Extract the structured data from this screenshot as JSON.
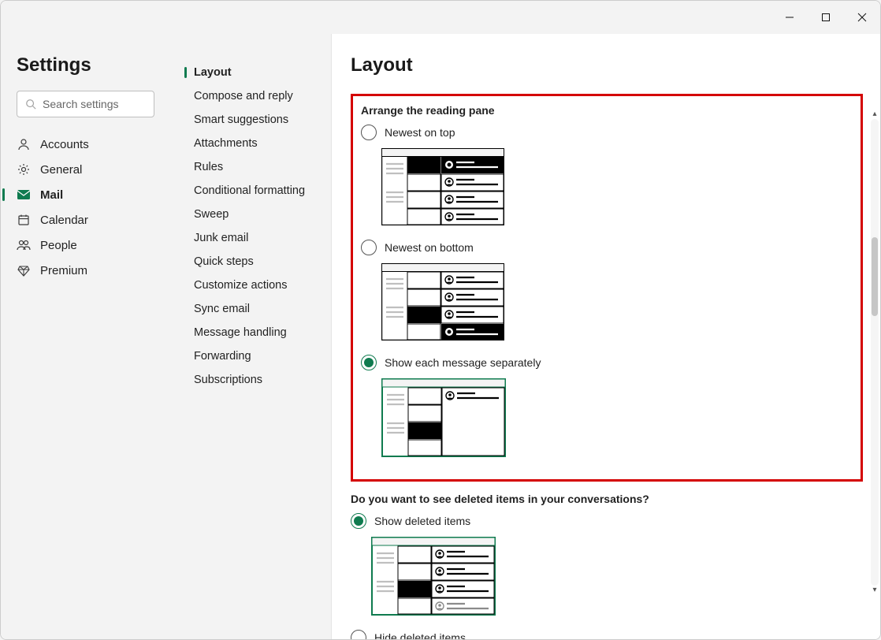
{
  "window_controls": {
    "minimize": "minimize",
    "maximize": "maximize",
    "close": "close"
  },
  "page_title": "Settings",
  "search": {
    "placeholder": "Search settings"
  },
  "primary_nav": [
    {
      "id": "accounts",
      "icon": "person",
      "label": "Accounts"
    },
    {
      "id": "general",
      "icon": "gear",
      "label": "General"
    },
    {
      "id": "mail",
      "icon": "mail",
      "label": "Mail",
      "active": true
    },
    {
      "id": "calendar",
      "icon": "calendar",
      "label": "Calendar"
    },
    {
      "id": "people",
      "icon": "people",
      "label": "People"
    },
    {
      "id": "premium",
      "icon": "diamond",
      "label": "Premium"
    }
  ],
  "secondary_nav": [
    {
      "id": "layout",
      "label": "Layout",
      "active": true
    },
    {
      "id": "compose",
      "label": "Compose and reply"
    },
    {
      "id": "smart",
      "label": "Smart suggestions"
    },
    {
      "id": "attachments",
      "label": "Attachments"
    },
    {
      "id": "rules",
      "label": "Rules"
    },
    {
      "id": "conditional",
      "label": "Conditional formatting"
    },
    {
      "id": "sweep",
      "label": "Sweep"
    },
    {
      "id": "junk",
      "label": "Junk email"
    },
    {
      "id": "quicksteps",
      "label": "Quick steps"
    },
    {
      "id": "customize",
      "label": "Customize actions"
    },
    {
      "id": "sync",
      "label": "Sync email"
    },
    {
      "id": "handling",
      "label": "Message handling"
    },
    {
      "id": "forwarding",
      "label": "Forwarding"
    },
    {
      "id": "subscriptions",
      "label": "Subscriptions"
    }
  ],
  "content": {
    "title": "Layout",
    "section1": {
      "title": "Arrange the reading pane",
      "options": [
        {
          "id": "newest-top",
          "label": "Newest on top",
          "selected": false
        },
        {
          "id": "newest-bottom",
          "label": "Newest on bottom",
          "selected": false
        },
        {
          "id": "separate",
          "label": "Show each message separately",
          "selected": true
        }
      ]
    },
    "section2": {
      "title": "Do you want to see deleted items in your conversations?",
      "options": [
        {
          "id": "show-deleted",
          "label": "Show deleted items",
          "selected": true
        },
        {
          "id": "hide-deleted",
          "label": "Hide deleted items",
          "selected": false
        }
      ]
    }
  }
}
